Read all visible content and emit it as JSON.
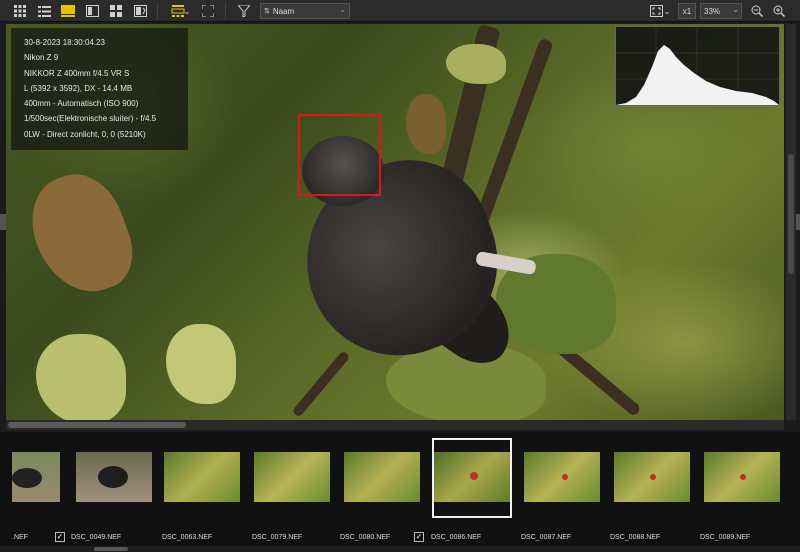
{
  "toolbar": {
    "sort_label": "Naam",
    "sort_prefix_icon": "sort-az-icon",
    "zoom_multiplier": "x1",
    "zoom_level": "33%",
    "accent_color": "#e6c400"
  },
  "info": {
    "lines": [
      "30-8-2023 18:30:04.23",
      "Nikon Z 9",
      "NIKKOR Z 400mm f/4.5 VR S",
      "L (5392 x 3592), DX - 14.4 MB",
      "400mm - Automatisch (ISO 900)",
      "1/500sec(Elektronische sluiter) - f/4.5",
      "0LW - Direct zonlicht, 0, 0 (5210K)"
    ]
  },
  "filmstrip": {
    "items": [
      {
        "label": ".NEF",
        "checked": false
      },
      {
        "label": "DSC_0049.NEF",
        "checked": true
      },
      {
        "label": "DSC_0063.NEF",
        "checked": false
      },
      {
        "label": "DSC_0079.NEF",
        "checked": false
      },
      {
        "label": "DSC_0080.NEF",
        "checked": false
      },
      {
        "label": "DSC_0086.NEF",
        "checked": true
      },
      {
        "label": "DSC_0087.NEF",
        "checked": false
      },
      {
        "label": "DSC_0088.NEF",
        "checked": false
      },
      {
        "label": "DSC_0089.NEF",
        "checked": false
      }
    ],
    "selected_index": 5
  }
}
